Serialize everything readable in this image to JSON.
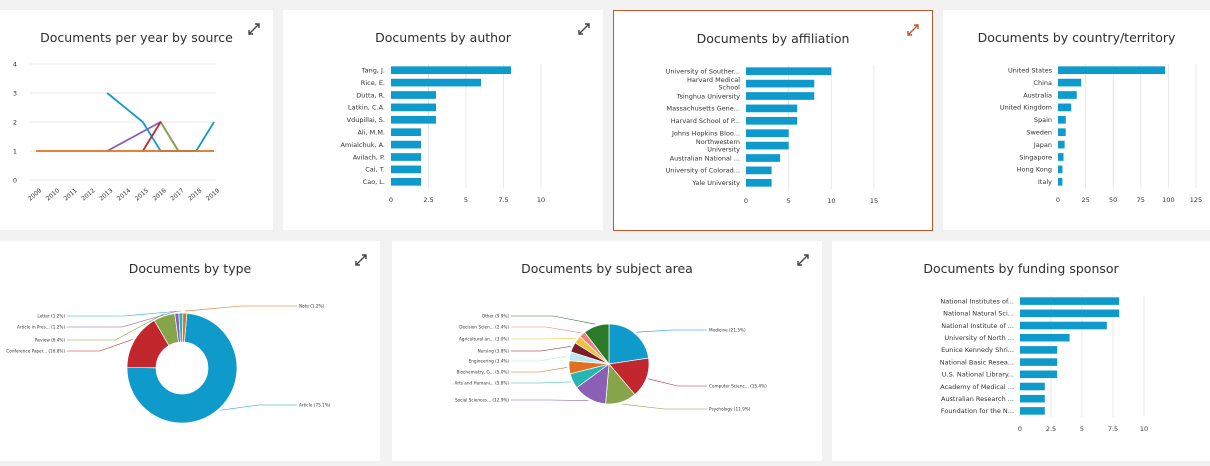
{
  "colors": {
    "bar": "#0e9bcc",
    "axis_text": "#333333",
    "grid": "#e8e8e8",
    "expand_icon": "#444444",
    "expand_icon_selected": "#c0582b",
    "pie": [
      "#0e9bcc",
      "#c1272d",
      "#86a54b",
      "#8b5fb5",
      "#25b5b5",
      "#e07020",
      "#b9e8ed",
      "#7a1f2a",
      "#eec33a",
      "#f08080",
      "#2a7a2a",
      "#5aa0d0"
    ]
  },
  "cards": {
    "year": {
      "title": "Documents per year by source",
      "expand_icon": "expand-icon"
    },
    "author": {
      "title": "Documents by author",
      "expand_icon": "expand-icon"
    },
    "affiliation": {
      "title": "Documents by affiliation",
      "expand_icon": "expand-icon"
    },
    "country": {
      "title": "Documents by country/territory",
      "expand_icon": "expand-icon"
    },
    "type": {
      "title": "Documents by type",
      "expand_icon": "expand-icon"
    },
    "subject": {
      "title": "Documents by subject area",
      "expand_icon": "expand-icon"
    },
    "funding": {
      "title": "Documents by funding sponsor",
      "expand_icon": "expand-icon"
    }
  },
  "chart_data": [
    {
      "id": "year",
      "type": "line",
      "title": "Documents per year by source",
      "x": [
        "2009",
        "2010",
        "2011",
        "2012",
        "2013",
        "2014",
        "2015",
        "2016",
        "2017",
        "2018",
        "2019"
      ],
      "ylim": [
        0,
        4
      ],
      "yticks": [
        0,
        1,
        2,
        3,
        4
      ],
      "grid": true,
      "series": [
        {
          "color": "#0e9bcc",
          "values": [
            null,
            null,
            null,
            null,
            3,
            null,
            2,
            1,
            1,
            1,
            2
          ]
        },
        {
          "color": "#8b5fb5",
          "values": [
            null,
            null,
            null,
            null,
            1,
            null,
            null,
            2,
            1,
            null,
            null
          ]
        },
        {
          "color": "#86a54b",
          "values": [
            null,
            null,
            null,
            null,
            null,
            null,
            null,
            2,
            1,
            null,
            null
          ]
        },
        {
          "color": "#c1272d",
          "values": [
            null,
            null,
            null,
            null,
            null,
            null,
            1,
            2,
            null,
            null,
            null
          ]
        },
        {
          "color": "#e07020",
          "values": [
            1,
            1,
            1,
            1,
            1,
            1,
            1,
            1,
            1,
            1,
            1
          ]
        }
      ]
    },
    {
      "id": "author",
      "type": "bar",
      "title": "Documents by author",
      "categories": [
        "Tang, J.",
        "Rice, E.",
        "Dutta, R.",
        "Latkin, C.A.",
        "Vdupillai, S.",
        "Ali, M.M.",
        "Amialchuk, A.",
        "Avilach, P.",
        "Cai, T.",
        "Cao, L."
      ],
      "values": [
        8,
        6,
        3,
        3,
        3,
        2,
        2,
        2,
        2,
        2
      ],
      "xlim": [
        0,
        10
      ],
      "xticks": [
        0,
        2.5,
        5,
        7.5,
        10
      ]
    },
    {
      "id": "affiliation",
      "type": "bar",
      "title": "Documents by affiliation",
      "categories": [
        "University of Souther...",
        "Harvard Medical School",
        "Tsinghua University",
        "Massachusetts Gene...",
        "Harvard School of P...",
        "Johns Hopkins Bloo...",
        "Northwestern University",
        "Australian National ...",
        "University of Colorad...",
        "Yale University"
      ],
      "values": [
        10,
        8,
        8,
        6,
        6,
        5,
        5,
        4,
        3,
        3
      ],
      "xlim": [
        0,
        15
      ],
      "xticks": [
        0,
        5,
        10,
        15
      ]
    },
    {
      "id": "country",
      "type": "bar",
      "title": "Documents by country/territory",
      "categories": [
        "United States",
        "China",
        "Australia",
        "United Kingdom",
        "Spain",
        "Sweden",
        "Japan",
        "Singapore",
        "Hong Kong",
        "Italy"
      ],
      "values": [
        97,
        21,
        17,
        12,
        7,
        7,
        6,
        5,
        4,
        4
      ],
      "xlim": [
        0,
        125
      ],
      "xticks": [
        0,
        25,
        50,
        75,
        100,
        125
      ]
    },
    {
      "id": "type",
      "type": "pie",
      "title": "Documents by type",
      "donut": true,
      "labels": [
        "Article (75.1%)",
        "Conference Paper... (16.8%)",
        "Review (6.4%)",
        "Article in Pres... (1.2%)",
        "Letter (1.2%)",
        "Note (1.2%)"
      ],
      "values": [
        75.1,
        16.8,
        6.4,
        1.2,
        1.2,
        1.2
      ]
    },
    {
      "id": "subject",
      "type": "pie",
      "title": "Documents by subject area",
      "donut": false,
      "labels": [
        "Medicine (21.5%)",
        "Computer Scienc... (15.4%)",
        "Psychology (11.9%)",
        "Social Sciences... (12.9%)",
        "Arts and Humani... (5.8%)",
        "Biochemistry, G... (5.0%)",
        "Engineering (3.4%)",
        "Nursing (3.8%)",
        "Agricultural an... (3.0%)",
        "Decision Scien... (2.4%)",
        "Other (9.9%)"
      ],
      "values": [
        21.5,
        15.4,
        11.9,
        12.9,
        5.8,
        5.0,
        3.4,
        3.8,
        3.0,
        2.4,
        9.9
      ]
    },
    {
      "id": "funding",
      "type": "bar",
      "title": "Documents by funding sponsor",
      "categories": [
        "National Institutes of...",
        "National Natural Sci...",
        "National Institute of ...",
        "University of North ...",
        "Eunice Kennedy Shri...",
        "National Basic Resea...",
        "U.S. National Library...",
        "Academy of Medical ...",
        "Australian Research ...",
        "Foundation for the N..."
      ],
      "values": [
        8,
        8,
        7,
        4,
        3,
        3,
        3,
        2,
        2,
        2
      ],
      "xlim": [
        0,
        10
      ],
      "xticks": [
        0,
        2.5,
        5,
        7.5,
        10
      ]
    }
  ]
}
